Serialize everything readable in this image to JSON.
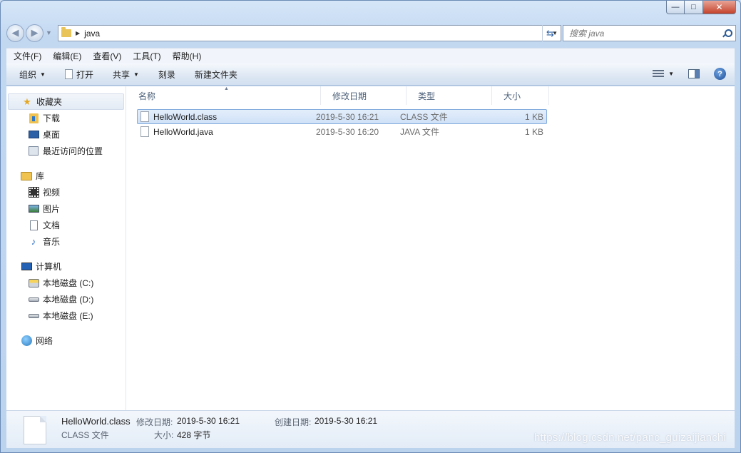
{
  "window": {
    "caption_min": "—",
    "caption_max": "□",
    "caption_close": "✕"
  },
  "address": {
    "path": "java",
    "search_placeholder": "搜索 java"
  },
  "menubar": {
    "items": [
      "文件(F)",
      "编辑(E)",
      "查看(V)",
      "工具(T)",
      "帮助(H)"
    ]
  },
  "toolbar": {
    "organize": "组织",
    "open": "打开",
    "share": "共享",
    "burn": "刻录",
    "new_folder": "新建文件夹",
    "help": "?"
  },
  "nav": {
    "favorites": "收藏夹",
    "downloads": "下载",
    "desktop": "桌面",
    "recent": "最近访问的位置",
    "libraries": "库",
    "videos": "视频",
    "pictures": "图片",
    "documents": "文档",
    "music": "音乐",
    "computer": "计算机",
    "drive_c": "本地磁盘 (C:)",
    "drive_d": "本地磁盘 (D:)",
    "drive_e": "本地磁盘 (E:)",
    "network": "网络"
  },
  "columns": {
    "name": "名称",
    "modified": "修改日期",
    "type": "类型",
    "size": "大小"
  },
  "files": [
    {
      "name": "HelloWorld.class",
      "modified": "2019-5-30 16:21",
      "type": "CLASS 文件",
      "size": "1 KB",
      "selected": true
    },
    {
      "name": "HelloWorld.java",
      "modified": "2019-5-30 16:20",
      "type": "JAVA 文件",
      "size": "1 KB",
      "selected": false
    }
  ],
  "details": {
    "filename": "HelloWorld.class",
    "filetype": "CLASS 文件",
    "modified_label": "修改日期:",
    "modified_value": "2019-5-30 16:21",
    "created_label": "创建日期:",
    "created_value": "2019-5-30 16:21",
    "size_label": "大小:",
    "size_value": "428 字节"
  },
  "watermark": "https://blog.csdn.net/panc_guizaijianchi"
}
